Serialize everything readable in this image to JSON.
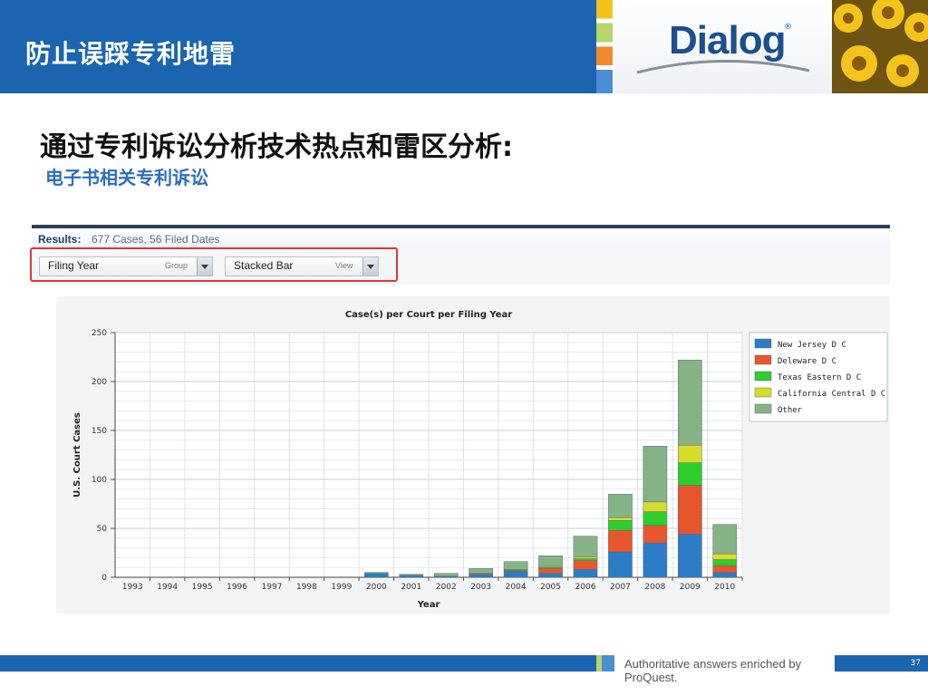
{
  "header": {
    "title": "防止误踩专利地雷",
    "logo_text": "Dialog",
    "logo_mark": "®"
  },
  "headline": "通过专利诉讼分析技术热点和雷区分析:",
  "subheadline": "电子书相关专利诉讼",
  "results": {
    "label": "Results:",
    "info": "677 Cases, 56 Filed Dates"
  },
  "controls": [
    {
      "value": "Filing Year",
      "sub": "Group"
    },
    {
      "value": "Stacked Bar",
      "sub": "View"
    }
  ],
  "footer": {
    "tagline": "Authoritative answers enriched by ProQuest.",
    "page_number": "37"
  },
  "chart_data": {
    "type": "bar",
    "stacked": true,
    "title": "Case(s) per Court per Filing Year",
    "xlabel": "Year",
    "ylabel": "U.S. Court Cases",
    "ylim": [
      0,
      250
    ],
    "yticks": [
      0,
      50,
      100,
      150,
      200,
      250
    ],
    "grid": true,
    "legend_position": "right",
    "categories": [
      "1993",
      "1994",
      "1995",
      "1996",
      "1997",
      "1998",
      "1999",
      "2000",
      "2001",
      "2002",
      "2003",
      "2004",
      "2005",
      "2006",
      "2007",
      "2008",
      "2009",
      "2010"
    ],
    "series": [
      {
        "name": "New Jersey D C",
        "color": "#2a7cc7",
        "values": [
          0,
          0,
          0,
          0,
          0,
          0,
          0,
          4,
          2,
          1,
          3,
          6,
          4,
          8,
          26,
          35,
          44,
          5
        ]
      },
      {
        "name": "Deleware D C",
        "color": "#e8562e",
        "values": [
          0,
          0,
          0,
          0,
          0,
          0,
          0,
          0,
          0,
          0,
          1,
          1,
          5,
          9,
          22,
          18,
          50,
          7
        ]
      },
      {
        "name": "Texas Eastern D C",
        "color": "#2ccf2c",
        "values": [
          0,
          0,
          0,
          0,
          0,
          0,
          0,
          0,
          0,
          0,
          0,
          1,
          1,
          2,
          10,
          14,
          23,
          6
        ]
      },
      {
        "name": "California Central D C",
        "color": "#d7dc2a",
        "values": [
          0,
          0,
          0,
          0,
          0,
          0,
          0,
          0,
          0,
          0,
          0,
          0,
          1,
          2,
          3,
          10,
          18,
          6
        ]
      },
      {
        "name": "Other",
        "color": "#86b386",
        "values": [
          0,
          0,
          0,
          0,
          0,
          0,
          0,
          1,
          1,
          3,
          5,
          8,
          11,
          21,
          24,
          57,
          87,
          30
        ]
      }
    ]
  }
}
